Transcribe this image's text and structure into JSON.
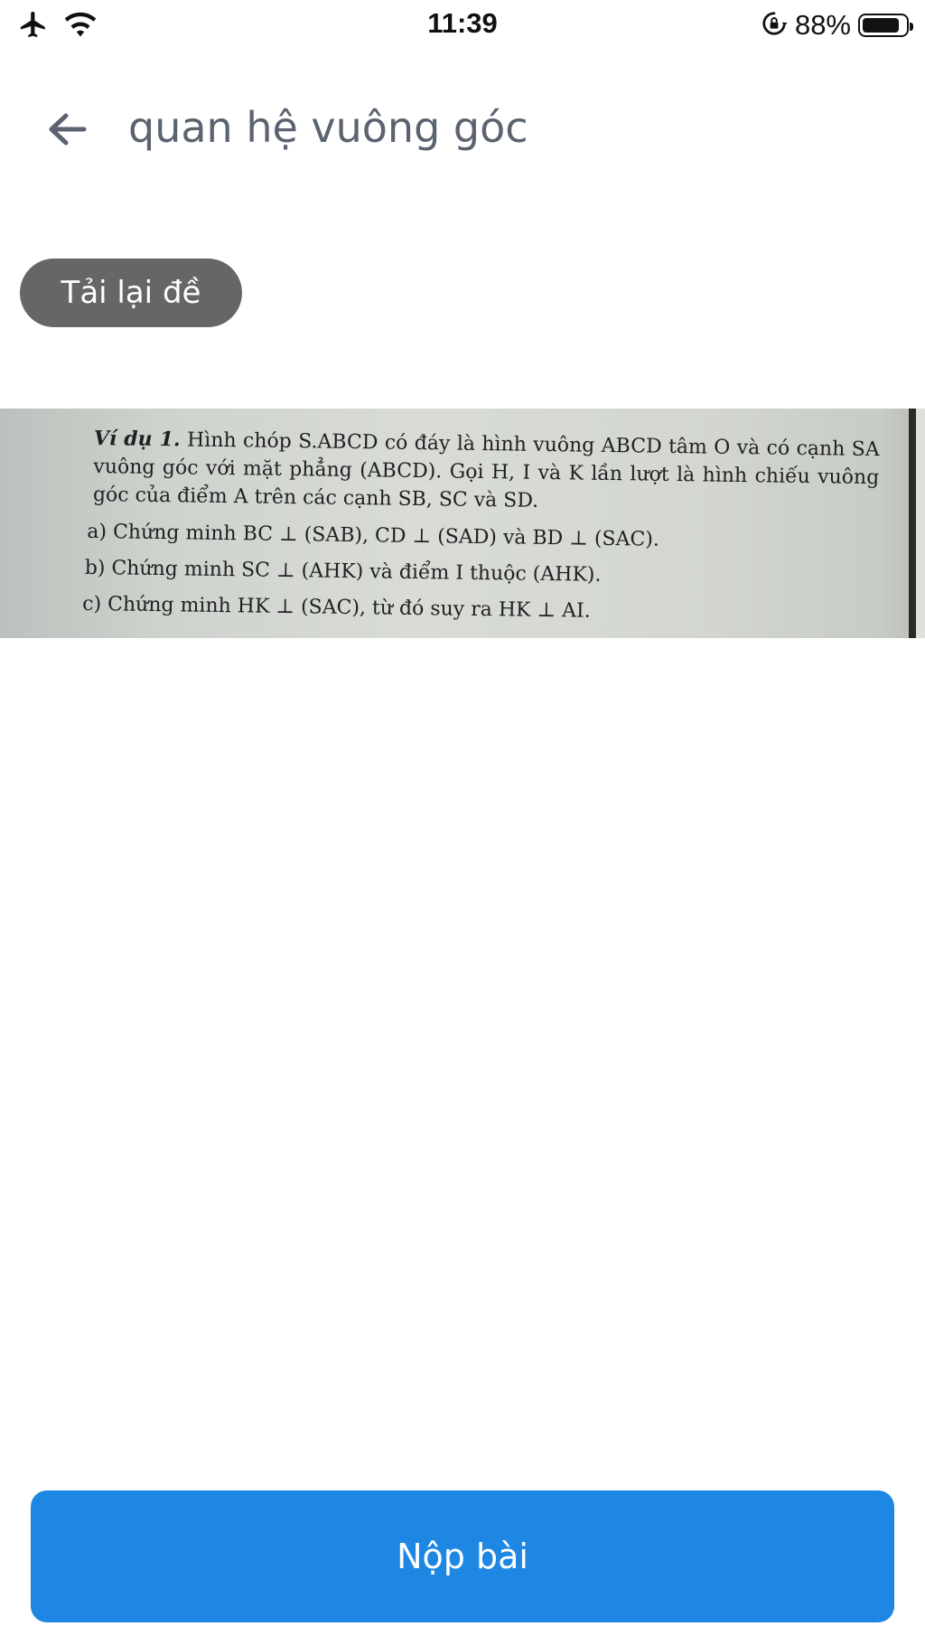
{
  "status_bar": {
    "time": "11:39",
    "battery_percent": "88%",
    "battery_level": 0.88,
    "icons": [
      "airplane-icon",
      "wifi-icon",
      "orientation-lock-icon",
      "battery-icon"
    ]
  },
  "header": {
    "back_icon": "arrow-left-icon",
    "title": "quan hệ vuông góc"
  },
  "reload_button": {
    "label": "Tải lại đề"
  },
  "question": {
    "example_label": "Ví dụ 1.",
    "intro": "Hình chóp S.ABCD có đáy là hình vuông ABCD tâm O và có cạnh SA vuông góc với mặt phẳng (ABCD). Gọi H, I và K lần lượt là hình chiếu vuông góc của điểm A trên các cạnh SB, SC và SD.",
    "items": [
      "a) Chứng minh BC ⊥ (SAB), CD ⊥ (SAD) và BD ⊥ (SAC).",
      "b) Chứng minh SC ⊥ (AHK) và điểm I thuộc (AHK).",
      "c) Chứng minh HK ⊥ (SAC), từ đó suy ra HK ⊥ AI."
    ]
  },
  "submit_button": {
    "label": "Nộp bài"
  },
  "colors": {
    "primary": "#1e86e3",
    "reload_bg": "#666666",
    "title": "#5b6270"
  }
}
